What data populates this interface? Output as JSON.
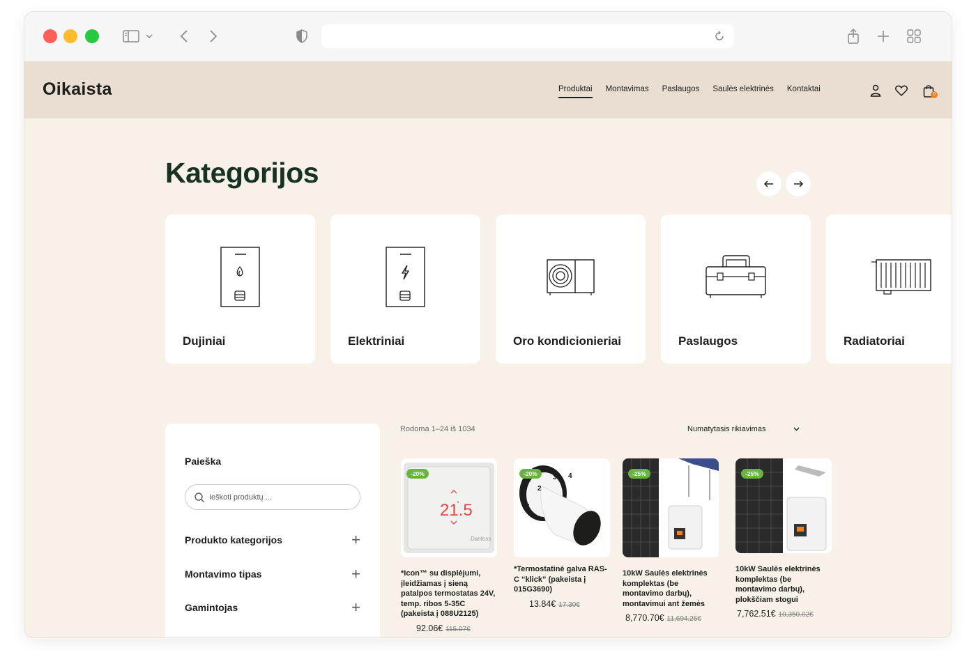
{
  "site": {
    "logo": "Oikaista",
    "nav": [
      "Produktai",
      "Montavimas",
      "Paslaugos",
      "Saulės elektrinės",
      "Kontaktai"
    ],
    "active_nav": "Produktai",
    "cart_count": "0"
  },
  "categories": {
    "title": "Kategorijos",
    "items": [
      {
        "label": "Dujiniai",
        "icon": "gas-boiler-icon"
      },
      {
        "label": "Elektriniai",
        "icon": "electric-boiler-icon"
      },
      {
        "label": "Oro kondicionieriai",
        "icon": "air-conditioner-icon"
      },
      {
        "label": "Paslaugos",
        "icon": "toolbox-icon"
      },
      {
        "label": "Radiatoriai",
        "icon": "radiator-icon"
      }
    ]
  },
  "sidebar": {
    "search_title": "Paieška",
    "search_placeholder": "Ieškoti produktų ...",
    "filters": [
      "Produkto kategorijos",
      "Montavimo tipas",
      "Gamintojas"
    ]
  },
  "listing": {
    "result_count": "Rodoma 1–24 iš 1034",
    "sort_label": "Numatytasis rikiavimas"
  },
  "products": [
    {
      "badge": "-20%",
      "name": "*Icon™ su displėjumi, įleidžiamas į sieną patalpos termostatas 24V, temp. ribos 5-35C (pakeista į 088U2125)",
      "price": "92.06€",
      "old_price": "115.07€"
    },
    {
      "badge": "-20%",
      "name": "*Termostatinė galva RAS-C “klick” (pakeista į 015G3690)",
      "price": "13.84€",
      "old_price": "17.30€"
    },
    {
      "badge": "-25%",
      "name": "10kW Saulės elektrinės komplektas (be montavimo darbų), montavimui ant žemės",
      "price": "8,770.70€",
      "old_price": "11,694.26€"
    },
    {
      "badge": "-25%",
      "name": "10kW Saulės elektrinės komplektas (be montavimo darbų), plokščiam stogui",
      "price": "7,762.51€",
      "old_price": "10,350.02€"
    }
  ],
  "colors": {
    "title": "#173222",
    "badge": "#6bb33e",
    "header_bg": "#e9ded1",
    "page_bg": "#f8f1e7"
  }
}
